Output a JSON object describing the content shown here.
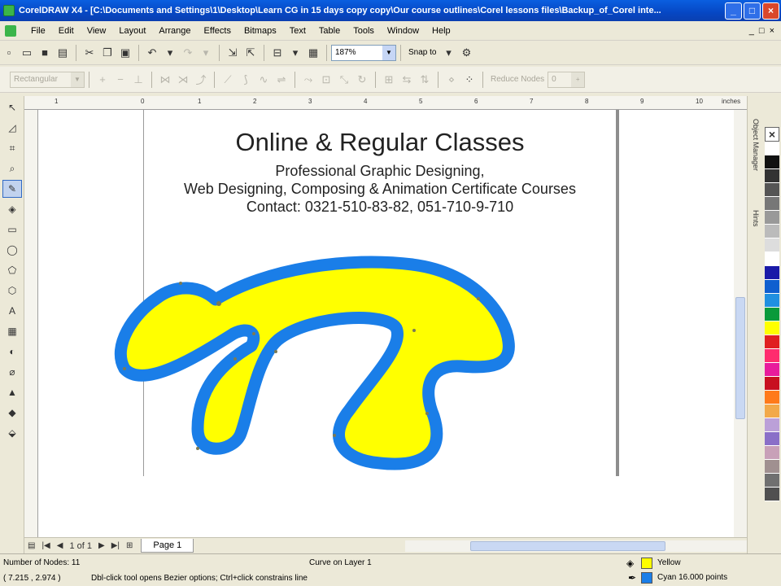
{
  "window": {
    "title": "CorelDRAW X4 - [C:\\Documents and Settings\\1\\Desktop\\Learn CG in 15 days copy copy\\Our course outlines\\Corel lessons files\\Backup_of_Corel inte...",
    "minimize": "_",
    "maximize": "□",
    "close": "×"
  },
  "menu": [
    "File",
    "Edit",
    "View",
    "Layout",
    "Arrange",
    "Effects",
    "Bitmaps",
    "Text",
    "Table",
    "Tools",
    "Window",
    "Help"
  ],
  "mdi_controls": [
    "_",
    "□",
    "×"
  ],
  "standard_toolbar": {
    "zoom_value": "187%",
    "snap_to_label": "Snap to"
  },
  "property_bar": {
    "shape_type": "Rectangular",
    "reduce_nodes_label": "Reduce Nodes",
    "reduce_nodes_value": "0"
  },
  "ruler": {
    "ticks": [
      "1",
      "0",
      "1",
      "2",
      "3",
      "4",
      "5",
      "6",
      "7",
      "8",
      "9",
      "10"
    ],
    "units": "inches"
  },
  "document": {
    "heading": "Online & Regular Classes",
    "line1": "Professional Graphic Designing,",
    "line2": "Web Designing, Composing & Animation Certificate Courses",
    "line3": "Contact: 0321-510-83-82, 051-710-9-710"
  },
  "shape": {
    "fill_color": "#ffff00",
    "outline_color": "#1a7ee8"
  },
  "dockers": {
    "object_manager": "Object Manager",
    "hints": "Hints"
  },
  "palette": [
    "#ffffff",
    "#111111",
    "#333333",
    "#555555",
    "#777777",
    "#999999",
    "#bbbbbb",
    "#dddddd",
    "#ffffff",
    "#1a1aa8",
    "#0f5fcf",
    "#2090e0",
    "#0a9a3a",
    "#ffff00",
    "#e02020",
    "#ff2c6e",
    "#e81b9c",
    "#c81020",
    "#ff7a1a",
    "#f2a94a",
    "#bba0d8",
    "#8a6fc8",
    "#c8a0b8",
    "#a09090",
    "#707070",
    "#505050"
  ],
  "page_nav": {
    "page_count": "1 of 1",
    "page_tab": "Page 1"
  },
  "status": {
    "nodes": "Number of Nodes: 11",
    "object": "Curve on Layer 1",
    "coords": "( 7.215 , 2.974 )",
    "hint": "Dbl-click tool opens Bezier options; Ctrl+click constrains line",
    "fill_name": "Yellow",
    "fill_color": "#ffff00",
    "outline_name": "Cyan  16.000 points",
    "outline_color": "#1a7ee8"
  }
}
